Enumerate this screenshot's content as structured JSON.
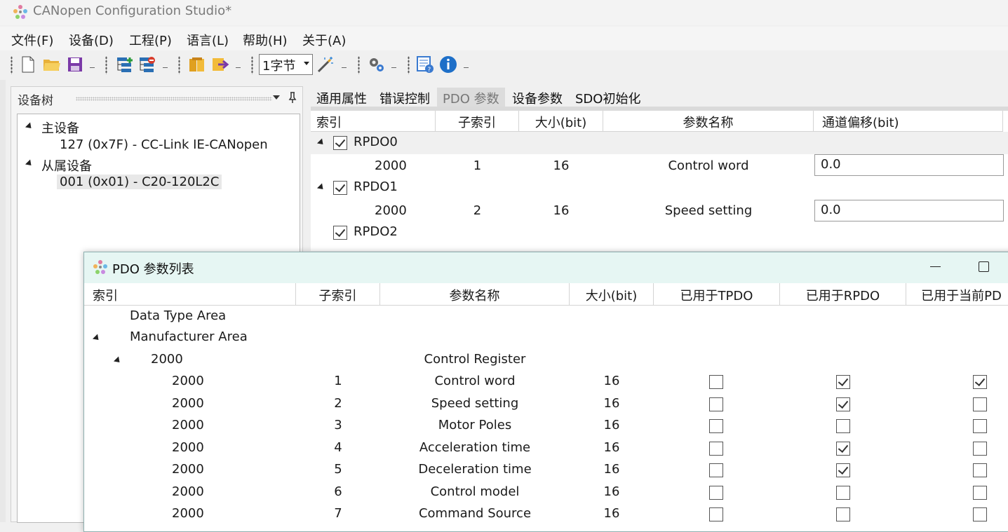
{
  "window": {
    "title": "CANopen Configuration Studio*"
  },
  "menu": [
    "文件(F)",
    "设备(D)",
    "工程(P)",
    "语言(L)",
    "帮助(H)",
    "关于(A)"
  ],
  "toolbar": {
    "byte_select": "1字节",
    "icons": [
      "new-file-icon",
      "open-folder-icon",
      "save-icon",
      "add-node-icon",
      "remove-node-icon",
      "import-icon",
      "export-icon",
      "magic-wand-icon",
      "settings-gear-icon",
      "help-icon",
      "info-icon"
    ]
  },
  "device_tree": {
    "title": "设备树",
    "master_label": "主设备",
    "master_item": "127 (0x7F)  -  CC-Link IE-CANopen",
    "slave_label": "从属设备",
    "slave_item": "001 (0x01)  -  C20-120L2C"
  },
  "tabs": [
    "通用属性",
    "错误控制",
    "PDO 参数",
    "设备参数",
    "SDO初始化"
  ],
  "active_tab": "PDO 参数",
  "pdo_grid": {
    "headers": [
      "索引",
      "子索引",
      "大小(bit)",
      "参数名称",
      "通道偏移(bit)"
    ],
    "groups": [
      {
        "name": "RPDO0",
        "checked": true,
        "expanded": true,
        "rows": [
          {
            "index": "2000",
            "subindex": "1",
            "size": "16",
            "name": "Control word",
            "offset": "0.0"
          }
        ]
      },
      {
        "name": "RPDO1",
        "checked": true,
        "expanded": true,
        "rows": [
          {
            "index": "2000",
            "subindex": "2",
            "size": "16",
            "name": "Speed setting",
            "offset": "0.0"
          }
        ]
      },
      {
        "name": "RPDO2",
        "checked": true,
        "expanded": false,
        "rows": []
      }
    ]
  },
  "dialog": {
    "title": "PDO 参数列表",
    "headers": [
      "索引",
      "子索引",
      "参数名称",
      "大小(bit)",
      "已用于TPDO",
      "已用于RPDO",
      "已用于当前PD"
    ],
    "areas": [
      "Data Type Area",
      "Manufacturer Area"
    ],
    "group": {
      "index": "2000",
      "name": "Control Register"
    },
    "rows": [
      {
        "index": "2000",
        "subindex": "1",
        "name": "Control word",
        "size": "16",
        "tpdo": false,
        "rpdo": true,
        "current": true
      },
      {
        "index": "2000",
        "subindex": "2",
        "name": "Speed setting",
        "size": "16",
        "tpdo": false,
        "rpdo": true,
        "current": false
      },
      {
        "index": "2000",
        "subindex": "3",
        "name": "Motor Poles",
        "size": "16",
        "tpdo": false,
        "rpdo": false,
        "current": false
      },
      {
        "index": "2000",
        "subindex": "4",
        "name": "Acceleration time",
        "size": "16",
        "tpdo": false,
        "rpdo": true,
        "current": false
      },
      {
        "index": "2000",
        "subindex": "5",
        "name": "Deceleration time",
        "size": "16",
        "tpdo": false,
        "rpdo": true,
        "current": false
      },
      {
        "index": "2000",
        "subindex": "6",
        "name": "Control model",
        "size": "16",
        "tpdo": false,
        "rpdo": false,
        "current": false
      },
      {
        "index": "2000",
        "subindex": "7",
        "name": "Command Source",
        "size": "16",
        "tpdo": false,
        "rpdo": false,
        "current": false
      }
    ]
  }
}
